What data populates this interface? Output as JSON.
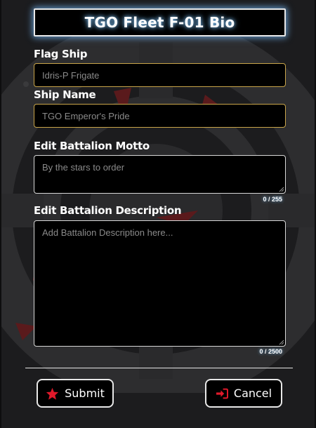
{
  "header": {
    "title": "TGO Fleet F-01 Bio"
  },
  "form": {
    "flag_ship": {
      "label": "Flag Ship",
      "placeholder": "Idris-P Frigate"
    },
    "ship_name": {
      "label": "Ship Name",
      "placeholder": "TGO Emperor's Pride"
    },
    "motto": {
      "label": "Edit Battalion Motto",
      "placeholder": "By the stars to order",
      "counter": "0 / 255"
    },
    "description": {
      "label": "Edit Battalion Description",
      "placeholder": "Add Battalion Description here...",
      "counter": "0 / 2500"
    }
  },
  "actions": {
    "submit_label": "Submit",
    "cancel_label": "Cancel",
    "submit_icon": "star-icon",
    "cancel_icon": "sign-in-icon"
  },
  "colors": {
    "background": "#1c1c1e",
    "accent_red": "#e0192a",
    "input_border": "#c9a54a",
    "title_glow": "#82c8ff"
  }
}
